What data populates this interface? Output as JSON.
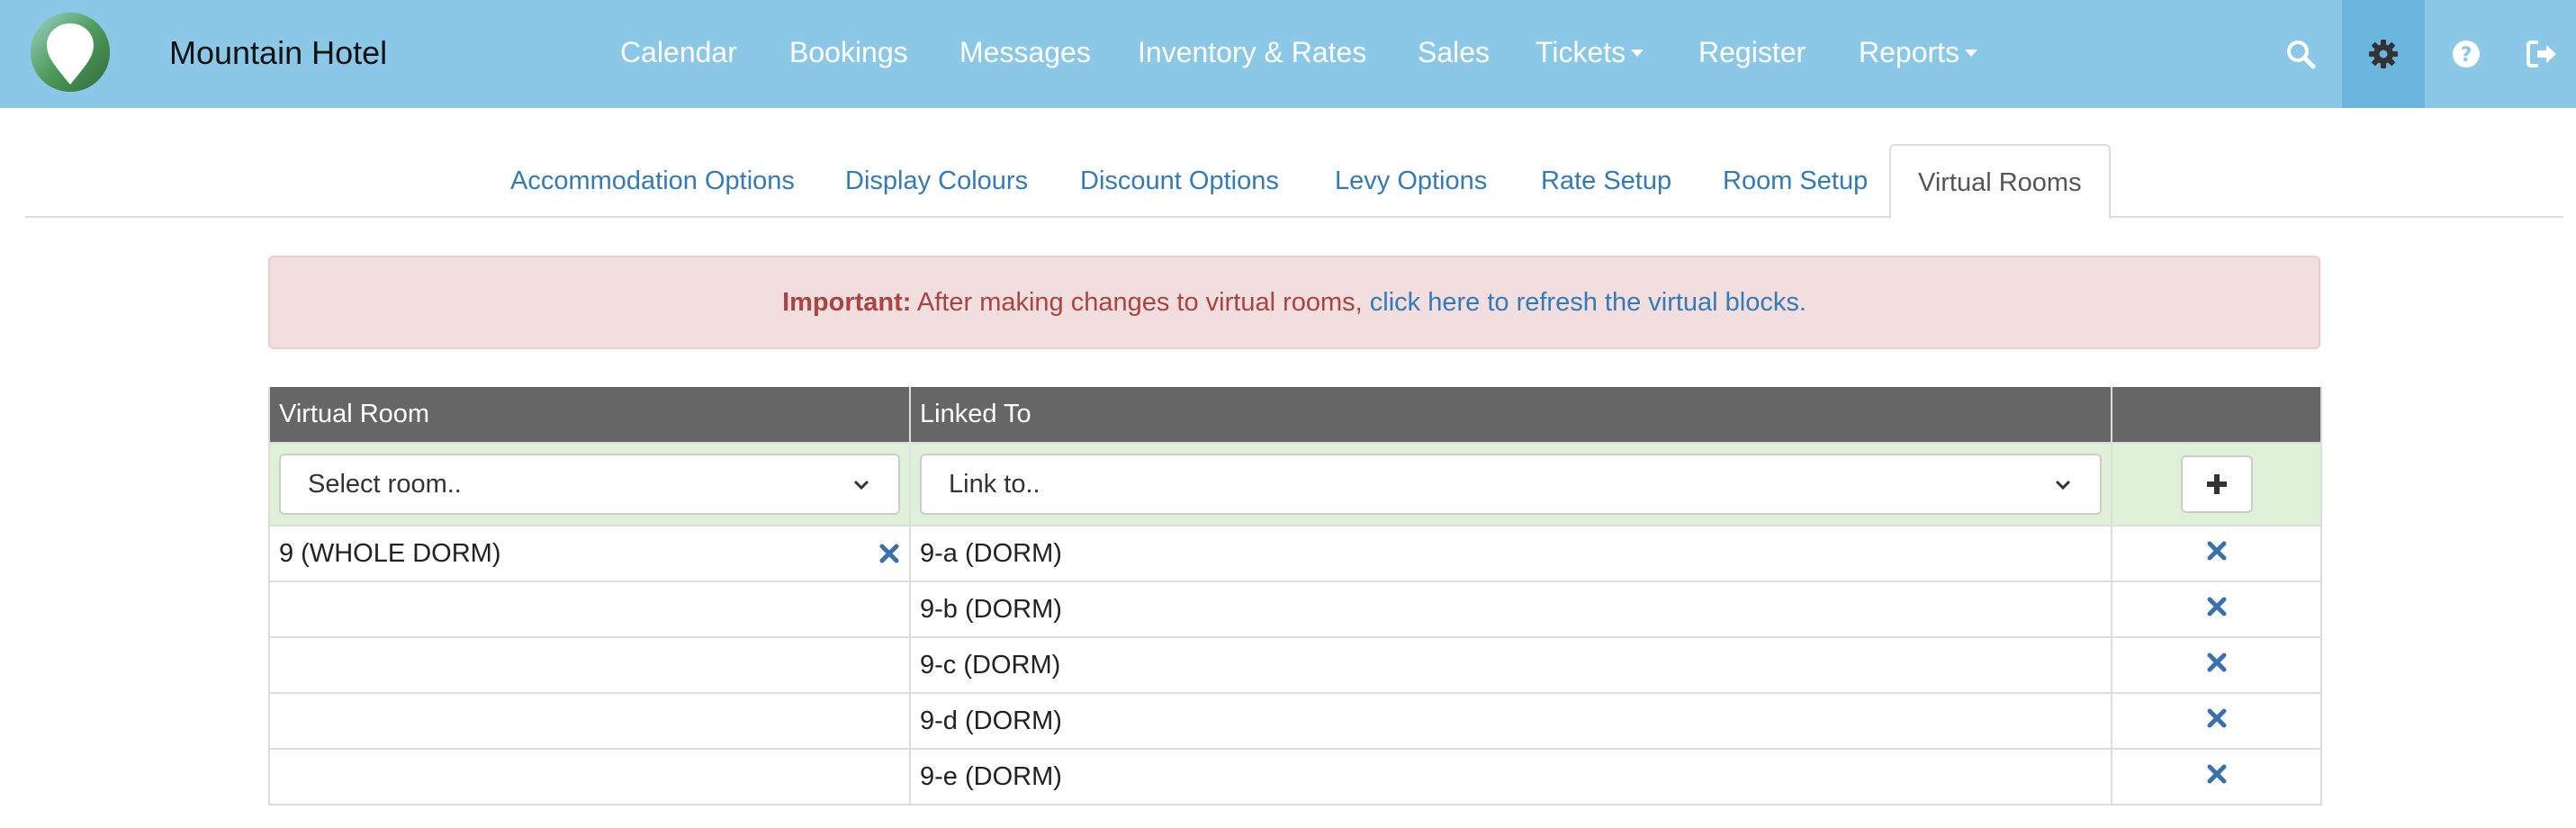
{
  "navbar": {
    "brand": "Mountain Hotel",
    "items": [
      {
        "label": "Calendar"
      },
      {
        "label": "Bookings"
      },
      {
        "label": "Messages"
      },
      {
        "label": "Inventory & Rates"
      },
      {
        "label": "Sales"
      },
      {
        "label": "Tickets",
        "dropdown": true
      },
      {
        "label": "Register"
      },
      {
        "label": "Reports",
        "dropdown": true
      }
    ],
    "icons": [
      "search-icon",
      "gear-icon",
      "help-icon",
      "logout-icon"
    ],
    "active_icon": "gear-icon"
  },
  "tabs": [
    {
      "label": "Accommodation Options"
    },
    {
      "label": "Display Colours"
    },
    {
      "label": "Discount Options"
    },
    {
      "label": "Levy Options"
    },
    {
      "label": "Rate Setup"
    },
    {
      "label": "Room Setup"
    },
    {
      "label": "Virtual Rooms",
      "active": true
    }
  ],
  "alert": {
    "strong": "Important:",
    "text": " After making changes to virtual rooms, ",
    "link": "click here to refresh the virtual blocks."
  },
  "table": {
    "headers": [
      "Virtual Room",
      "Linked To",
      ""
    ],
    "room_select_value": "Select room..",
    "link_select_value": "Link to..",
    "rows": [
      {
        "virtual_room": "9 (WHOLE DORM)",
        "linked_to": "9-a (DORM)"
      },
      {
        "virtual_room": "",
        "linked_to": "9-b (DORM)"
      },
      {
        "virtual_room": "",
        "linked_to": "9-c (DORM)"
      },
      {
        "virtual_room": "",
        "linked_to": "9-d (DORM)"
      },
      {
        "virtual_room": "",
        "linked_to": "9-e (DORM)"
      }
    ]
  },
  "colors": {
    "navbar_bg": "#8bc8e8",
    "link": "#337ab7",
    "alert_bg": "#f2dede",
    "alert_text": "#a94442",
    "table_header_bg": "#666666",
    "input_row_bg": "#dff0d8",
    "remove_icon": "#3a6fb0"
  }
}
